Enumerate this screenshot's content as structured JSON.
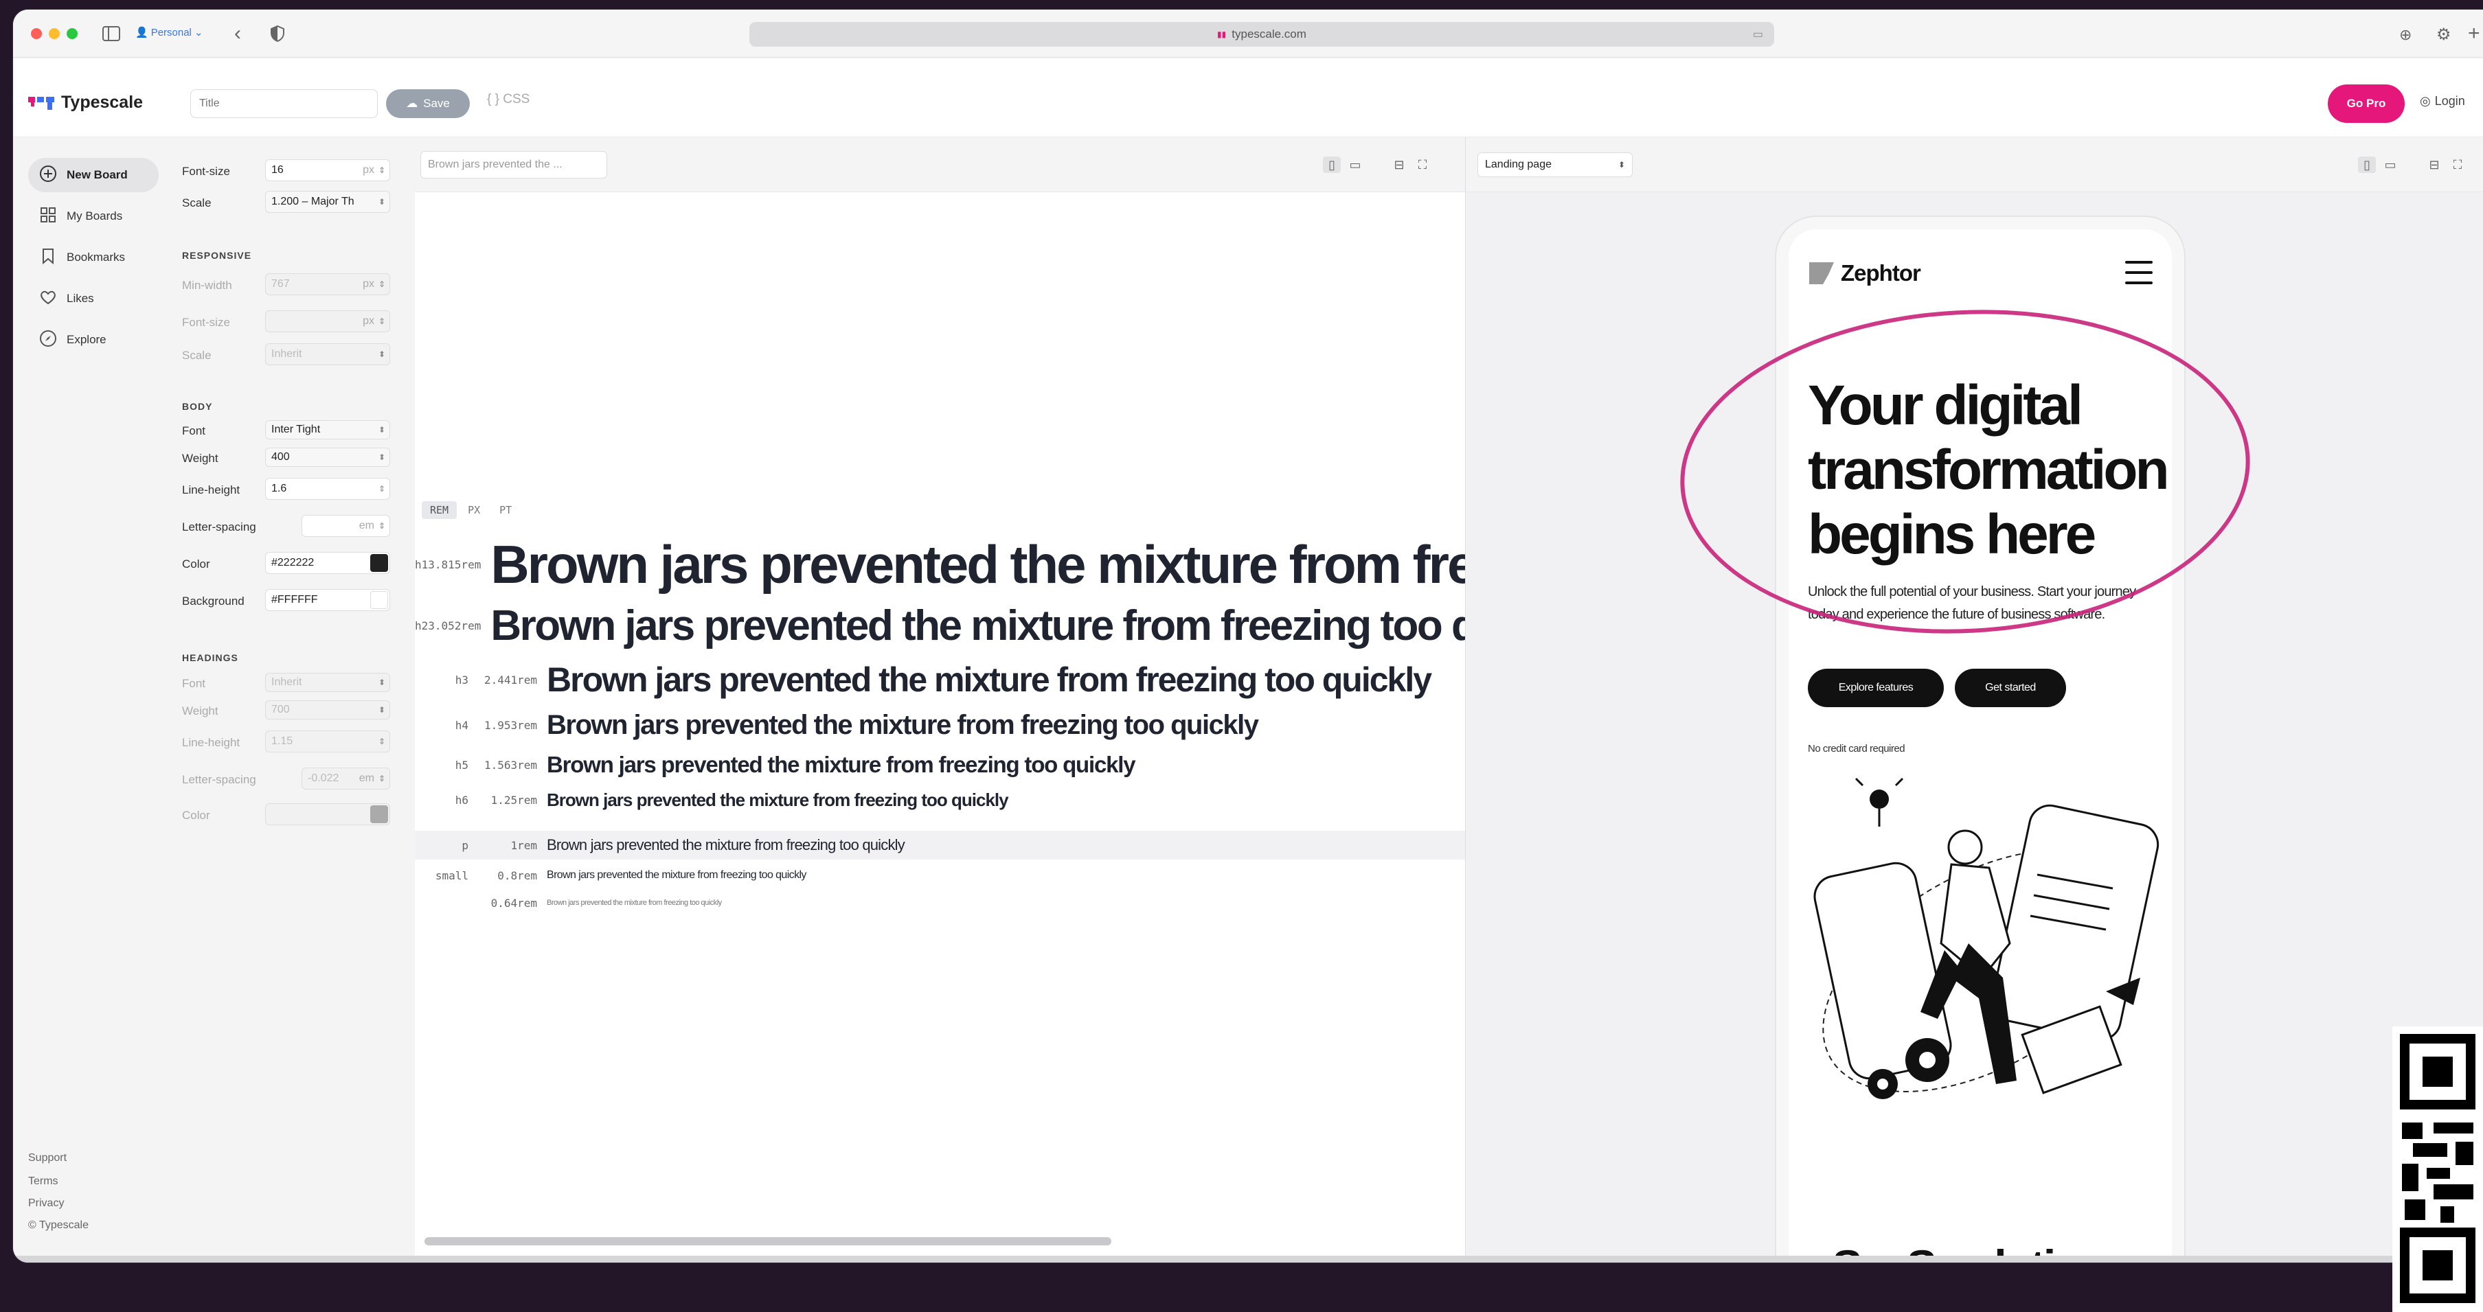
{
  "browser": {
    "profile": "Personal",
    "url": "typescale.com"
  },
  "header": {
    "brand": "Typescale",
    "title_placeholder": "Title",
    "save_label": "Save",
    "css_label": "CSS",
    "gopro_label": "Go Pro",
    "login_label": "Login",
    "colors": {
      "gopro": "#e5177b"
    }
  },
  "sidebar": {
    "items": [
      {
        "label": "New Board",
        "icon": "plus-circle-icon"
      },
      {
        "label": "My Boards",
        "icon": "grid-icon"
      },
      {
        "label": "Bookmarks",
        "icon": "bookmark-icon"
      },
      {
        "label": "Likes",
        "icon": "heart-icon"
      },
      {
        "label": "Explore",
        "icon": "compass-icon"
      }
    ],
    "footer": [
      "Support",
      "Terms",
      "Privacy",
      "© Typescale"
    ]
  },
  "settings": {
    "font_size_label": "Font-size",
    "font_size": "16",
    "font_size_unit": "px",
    "scale_label": "Scale",
    "scale": "1.200 – Major Th",
    "responsive": {
      "heading": "RESPONSIVE",
      "min_width_label": "Min-width",
      "min_width": "767",
      "min_width_unit": "px",
      "font_size_label": "Font-size",
      "font_size_unit": "px",
      "scale_label": "Scale",
      "scale": "Inherit"
    },
    "body": {
      "heading": "BODY",
      "font_label": "Font",
      "font": "Inter Tight",
      "weight_label": "Weight",
      "weight": "400",
      "line_height_label": "Line-height",
      "line_height": "1.6",
      "letter_spacing_label": "Letter-spacing",
      "letter_spacing_unit": "em",
      "color_label": "Color",
      "color": "#222222",
      "background_label": "Background",
      "background": "#FFFFFF"
    },
    "headings": {
      "heading": "HEADINGS",
      "font_label": "Font",
      "font": "Inherit",
      "weight_label": "Weight",
      "weight": "700",
      "line_height_label": "Line-height",
      "line_height": "1.15",
      "letter_spacing_label": "Letter-spacing",
      "letter_spacing": "-0.022",
      "letter_spacing_unit": "em",
      "color_label": "Color"
    }
  },
  "preview_text": {
    "input_value": "Brown jars prevented the ...",
    "units": [
      "REM",
      "PX",
      "PT"
    ],
    "sample": "Brown jars prevented the mixture from freezing too quickly",
    "rows": [
      {
        "tag": "h1",
        "value": "3.815rem"
      },
      {
        "tag": "h2",
        "value": "3.052rem"
      },
      {
        "tag": "h3",
        "value": "2.441rem"
      },
      {
        "tag": "h4",
        "value": "1.953rem"
      },
      {
        "tag": "h5",
        "value": "1.563rem"
      },
      {
        "tag": "h6",
        "value": "1.25rem"
      },
      {
        "tag": "p",
        "value": "1rem"
      },
      {
        "tag": "small",
        "value": "0.8rem"
      },
      {
        "tag": "",
        "value": "0.64rem"
      }
    ]
  },
  "landing": {
    "select": "Landing page",
    "brand": "Zephtor",
    "headline": "Your digital transformation begins here",
    "subtext": "Unlock the full potential of your business. Start your journey today and experience the future of business software.",
    "cta_primary": "Explore features",
    "cta_secondary": "Get started",
    "note": "No credit card required",
    "section_title": "SaaS solutions",
    "colors": {
      "annotation": "#c8227a"
    }
  }
}
